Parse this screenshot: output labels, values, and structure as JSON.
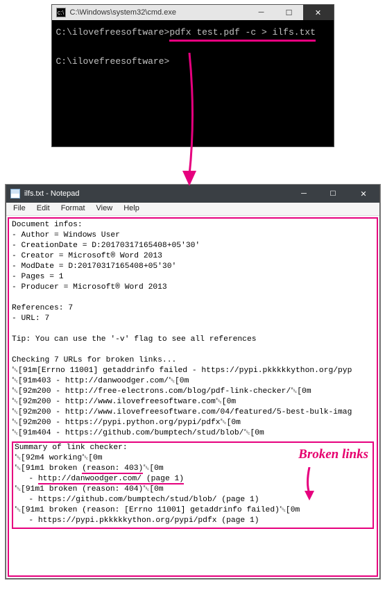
{
  "cmd": {
    "title": "C:\\Windows\\system32\\cmd.exe",
    "line1_prompt": "C:\\ilovefreesoftware>",
    "line1_cmd": "pdfx test.pdf -c > ilfs.txt",
    "line2": "C:\\ilovefreesoftware>"
  },
  "notepad": {
    "title": "ilfs.txt - Notepad",
    "menu": {
      "file": "File",
      "edit": "Edit",
      "format": "Format",
      "view": "View",
      "help": "Help"
    },
    "body": {
      "l1": "Document infos:",
      "l2": "- Author = Windows User",
      "l3": "- CreationDate = D:20170317165408+05'30'",
      "l4": "- Creator = Microsoft® Word 2013",
      "l5": "- ModDate = D:20170317165408+05'30'",
      "l6": "- Pages = 1",
      "l7": "- Producer = Microsoft® Word 2013",
      "l8": "",
      "l9": "References: 7",
      "l10": "- URL: 7",
      "l11": "",
      "l12": "Tip: You can use the '-v' flag to see all references",
      "l13": "",
      "l14": "Checking 7 URLs for broken links...",
      "l15": "␛[91m[Errno 11001] getaddrinfo failed - https://pypi.pkkkkkython.org/pyp",
      "l16": "␛[91m403 - http://danwoodger.com/␛[0m",
      "l17": "␛[92m200 - http://free-electrons.com/blog/pdf-link-checker/␛[0m",
      "l18": "␛[92m200 - http://www.ilovefreesoftware.com␛[0m",
      "l19": "␛[92m200 - http://www.ilovefreesoftware.com/04/featured/5-best-bulk-imag",
      "l20": "␛[92m200 - https://pypi.python.org/pypi/pdfx␛[0m",
      "l21": "␛[91m404 - https://github.com/bumptech/stud/blob/␛[0m"
    },
    "summary": {
      "s1": "Summary of link checker:",
      "s2": "␛[92m4 working␛[0m",
      "s3a": "␛[91m1 broken ",
      "s3b": "(reason: 403)",
      "s3c": "␛[0m",
      "s4a": "   - ",
      "s4b": "http://danwoodger.com/ (page 1)",
      "s5": "␛[91m1 broken (reason: 404)␛[0m",
      "s6": "   - https://github.com/bumptech/stud/blob/ (page 1)",
      "s7": "␛[91m1 broken (reason: [Errno 11001] getaddrinfo failed)␛[0m",
      "s8": "   - https://pypi.pkkkkkython.org/pypi/pdfx (page 1)"
    }
  },
  "annotation": {
    "broken_links": "Broken links"
  }
}
